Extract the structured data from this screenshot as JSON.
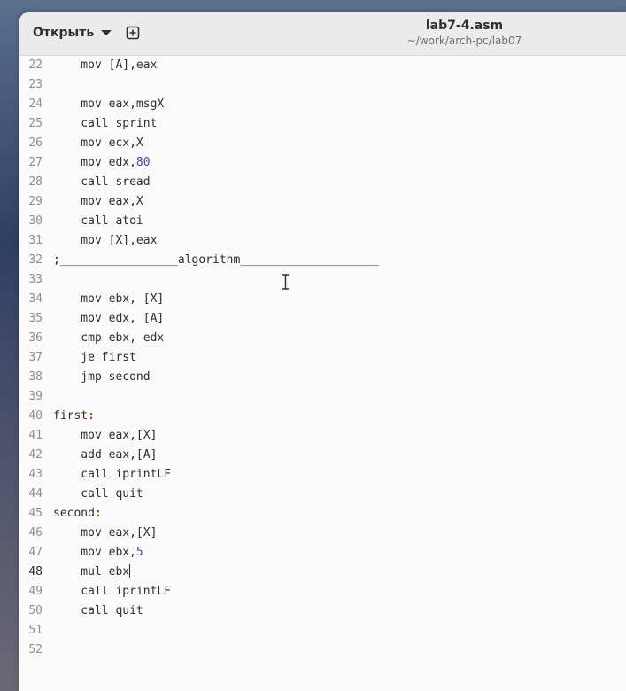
{
  "header": {
    "open_label": "Открыть",
    "title": "lab7-4.asm",
    "path": "~/work/arch-pc/lab07"
  },
  "icons": {
    "open_dropdown": "chevron-down-icon",
    "new_tab": "new-document-icon",
    "mouse_cursor": "text-cursor-icon"
  },
  "colors": {
    "number": "#3b4ca8",
    "label_colon": "#c1440e",
    "text": "#2e2e2e",
    "line_number": "#8f8f8f"
  },
  "editor": {
    "current_line": "48",
    "lines": [
      {
        "n": "22",
        "parts": [
          "    mov [A],eax"
        ]
      },
      {
        "n": "23",
        "parts": [
          ""
        ]
      },
      {
        "n": "24",
        "parts": [
          "    mov eax,msgX"
        ]
      },
      {
        "n": "25",
        "parts": [
          "    call sprint"
        ]
      },
      {
        "n": "26",
        "parts": [
          "    mov ecx,X"
        ]
      },
      {
        "n": "27",
        "parts": [
          "    mov edx,",
          "80"
        ]
      },
      {
        "n": "28",
        "parts": [
          "    call sread"
        ]
      },
      {
        "n": "29",
        "parts": [
          "    mov eax,X"
        ]
      },
      {
        "n": "30",
        "parts": [
          "    call atoi"
        ]
      },
      {
        "n": "31",
        "parts": [
          "    mov [X],eax"
        ]
      },
      {
        "n": "32",
        "parts": [
          ";_________________algorithm____________________"
        ]
      },
      {
        "n": "33",
        "parts": [
          ""
        ]
      },
      {
        "n": "34",
        "parts": [
          "    mov ebx, [X]"
        ]
      },
      {
        "n": "35",
        "parts": [
          "    mov edx, [A]"
        ]
      },
      {
        "n": "36",
        "parts": [
          "    cmp ebx, edx"
        ]
      },
      {
        "n": "37",
        "parts": [
          "    je first"
        ]
      },
      {
        "n": "38",
        "parts": [
          "    jmp second"
        ]
      },
      {
        "n": "39",
        "parts": [
          ""
        ]
      },
      {
        "n": "40",
        "parts": [
          "first",
          ":"
        ]
      },
      {
        "n": "41",
        "parts": [
          "    mov eax,[X]"
        ]
      },
      {
        "n": "42",
        "parts": [
          "    add eax,[A]"
        ]
      },
      {
        "n": "43",
        "parts": [
          "    call iprintLF"
        ]
      },
      {
        "n": "44",
        "parts": [
          "    call quit"
        ]
      },
      {
        "n": "45",
        "parts": [
          "second",
          ":"
        ]
      },
      {
        "n": "46",
        "parts": [
          "    mov eax,[X]"
        ]
      },
      {
        "n": "47",
        "parts": [
          "    mov ebx,",
          "5"
        ]
      },
      {
        "n": "48",
        "parts": [
          "    mul ebx"
        ]
      },
      {
        "n": "49",
        "parts": [
          "    call iprintLF"
        ]
      },
      {
        "n": "50",
        "parts": [
          "    call quit"
        ]
      },
      {
        "n": "51",
        "parts": [
          ""
        ]
      },
      {
        "n": "52",
        "parts": [
          ""
        ]
      }
    ]
  }
}
